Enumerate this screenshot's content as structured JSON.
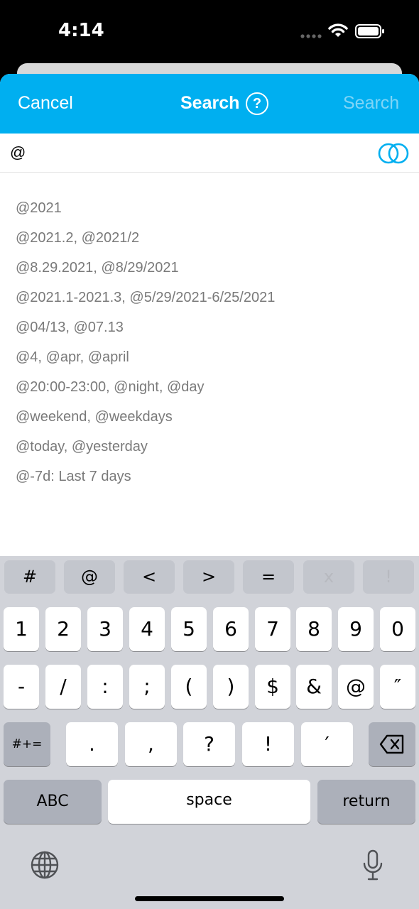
{
  "status": {
    "time": "4:14"
  },
  "nav": {
    "cancel": "Cancel",
    "title": "Search",
    "help": "?",
    "search": "Search"
  },
  "search": {
    "value": "@"
  },
  "suggestions": [
    "@2021",
    "@2021.2, @2021/2",
    "@8.29.2021, @8/29/2021",
    "@2021.1-2021.3, @5/29/2021-6/25/2021",
    "@04/13, @07.13",
    "@4, @apr, @april",
    "@20:00-23:00, @night, @day",
    "@weekend, @weekdays",
    "@today, @yesterday",
    "@-7d: Last 7 days"
  ],
  "keyboard": {
    "special_row": [
      "#",
      "@",
      "<",
      ">",
      "=",
      "x",
      "!"
    ],
    "row1": [
      "1",
      "2",
      "3",
      "4",
      "5",
      "6",
      "7",
      "8",
      "9",
      "0"
    ],
    "row2": [
      "-",
      "/",
      ":",
      ";",
      "(",
      ")",
      "$",
      "&",
      "@",
      "″"
    ],
    "row3": [
      ".",
      ",",
      "?",
      "!",
      "′"
    ],
    "symbols": "#+=",
    "abc": "ABC",
    "space": "space",
    "return": "return"
  },
  "icons": {
    "help": "help-circle-icon",
    "venn": "venn-toggle-icon",
    "backspace": "backspace-icon",
    "globe": "globe-icon",
    "mic": "microphone-icon"
  },
  "colors": {
    "accent": "#00aff0",
    "keyboard_bg": "#d1d3d9",
    "suggestion_text": "#7a7a7a"
  }
}
